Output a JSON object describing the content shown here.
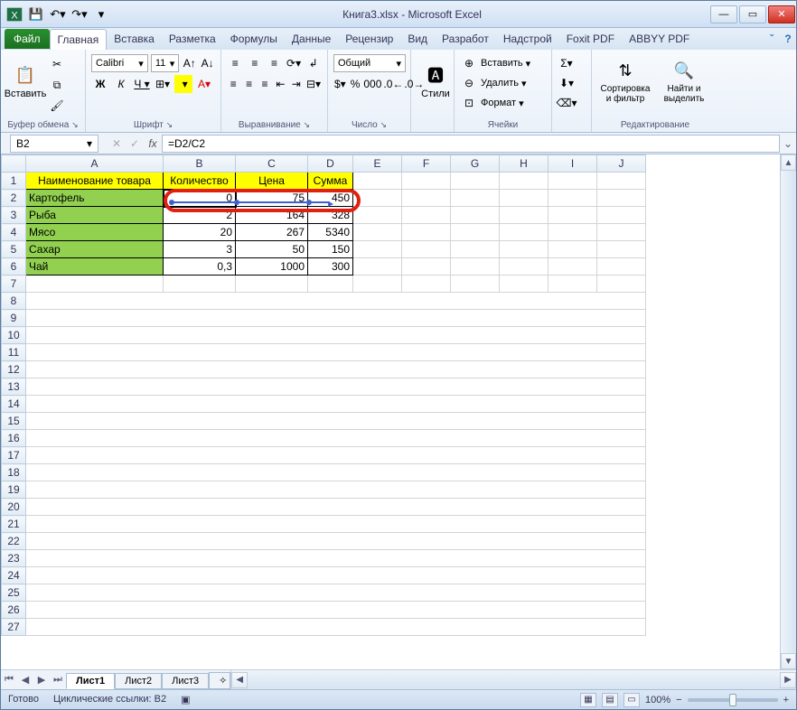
{
  "title": "Книга3.xlsx - Microsoft Excel",
  "tabs": {
    "file": "Файл",
    "home": "Главная",
    "insert": "Вставка",
    "layout": "Разметка",
    "formulas": "Формулы",
    "data": "Данные",
    "review": "Рецензир",
    "view": "Вид",
    "dev": "Разработ",
    "addins": "Надстрой",
    "foxit": "Foxit PDF",
    "abbyy": "ABBYY PDF"
  },
  "ribbon": {
    "paste": "Вставить",
    "clipboard": "Буфер обмена",
    "font_name": "Calibri",
    "font_size": "11",
    "font": "Шрифт",
    "alignment": "Выравнивание",
    "general": "Общий",
    "number": "Число",
    "styles": "Стили",
    "insert_c": "Вставить",
    "delete_c": "Удалить",
    "format_c": "Формат",
    "cells": "Ячейки",
    "sort": "Сортировка и фильтр",
    "find": "Найти и выделить",
    "editing": "Редактирование"
  },
  "formula_bar": {
    "name": "B2",
    "formula": "=D2/C2"
  },
  "columns": [
    "A",
    "B",
    "C",
    "D",
    "E",
    "F",
    "G",
    "H",
    "I",
    "J"
  ],
  "headers": {
    "a": "Наименование товара",
    "b": "Количество",
    "c": "Цена",
    "d": "Сумма"
  },
  "rows": [
    {
      "name": "Картофель",
      "qty": "0",
      "price": "75",
      "sum": "450"
    },
    {
      "name": "Рыба",
      "qty": "2",
      "price": "164",
      "sum": "328"
    },
    {
      "name": "Мясо",
      "qty": "20",
      "price": "267",
      "sum": "5340"
    },
    {
      "name": "Сахар",
      "qty": "3",
      "price": "50",
      "sum": "150"
    },
    {
      "name": "Чай",
      "qty": "0,3",
      "price": "1000",
      "sum": "300"
    }
  ],
  "sheets": {
    "s1": "Лист1",
    "s2": "Лист2",
    "s3": "Лист3"
  },
  "status": {
    "ready": "Готово",
    "circular": "Циклические ссылки: B2",
    "zoom": "100%"
  }
}
